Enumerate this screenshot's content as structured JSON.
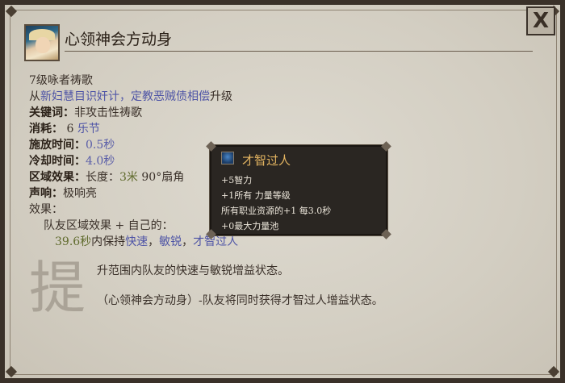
{
  "window": {
    "close_label": "X",
    "title": "心领神会方动身"
  },
  "ability": {
    "level_line": "7级咏者祷歌",
    "upgrade_prefix": "从",
    "upgrade_link": "新妇慧目识奸计，定教恶贼债相偿",
    "upgrade_suffix": "升级",
    "keywords_label": "关键词：",
    "keywords_value": "非攻击性祷歌",
    "cost_label": "消耗：",
    "cost_number": "6",
    "cost_unit": "乐节",
    "cast_label": "施放时间：",
    "cast_value": "0.5秒",
    "cooldown_label": "冷却时间：",
    "cooldown_value": "4.0秒",
    "area_label": "区域效果：",
    "area_length_label": "长度：",
    "area_length_value": "3米",
    "area_angle": "90°扇角",
    "volume_label": "声响：",
    "volume_value": "极响亮",
    "effects_label": "效果：",
    "effect_target": "队友区域效果 + 自己的：",
    "effect_duration": "39.6秒",
    "effect_keep": "内保持",
    "effect_buff1": "快速",
    "effect_sep1": "，",
    "effect_buff2": "敏锐",
    "effect_sep2": "，",
    "effect_buff3": "才智过人"
  },
  "watermark": "提",
  "descriptions": {
    "line1": "升范围内队友的快速与敏锐增益状态。",
    "line2": "（心领神会方动身）-队友将同时获得才智过人增益状态。"
  },
  "tooltip": {
    "icon": "intellect-buff-icon",
    "title": "才智过人",
    "lines": [
      "+5智力",
      "+1所有 力量等级",
      "所有职业资源的+1 每3.0秒",
      "+0最大力量池"
    ]
  },
  "colors": {
    "parchment": "#d6d1c5",
    "link_blue": "#4f55a6",
    "tooltip_bg": "#2a2622",
    "tooltip_title": "#e4b561"
  }
}
